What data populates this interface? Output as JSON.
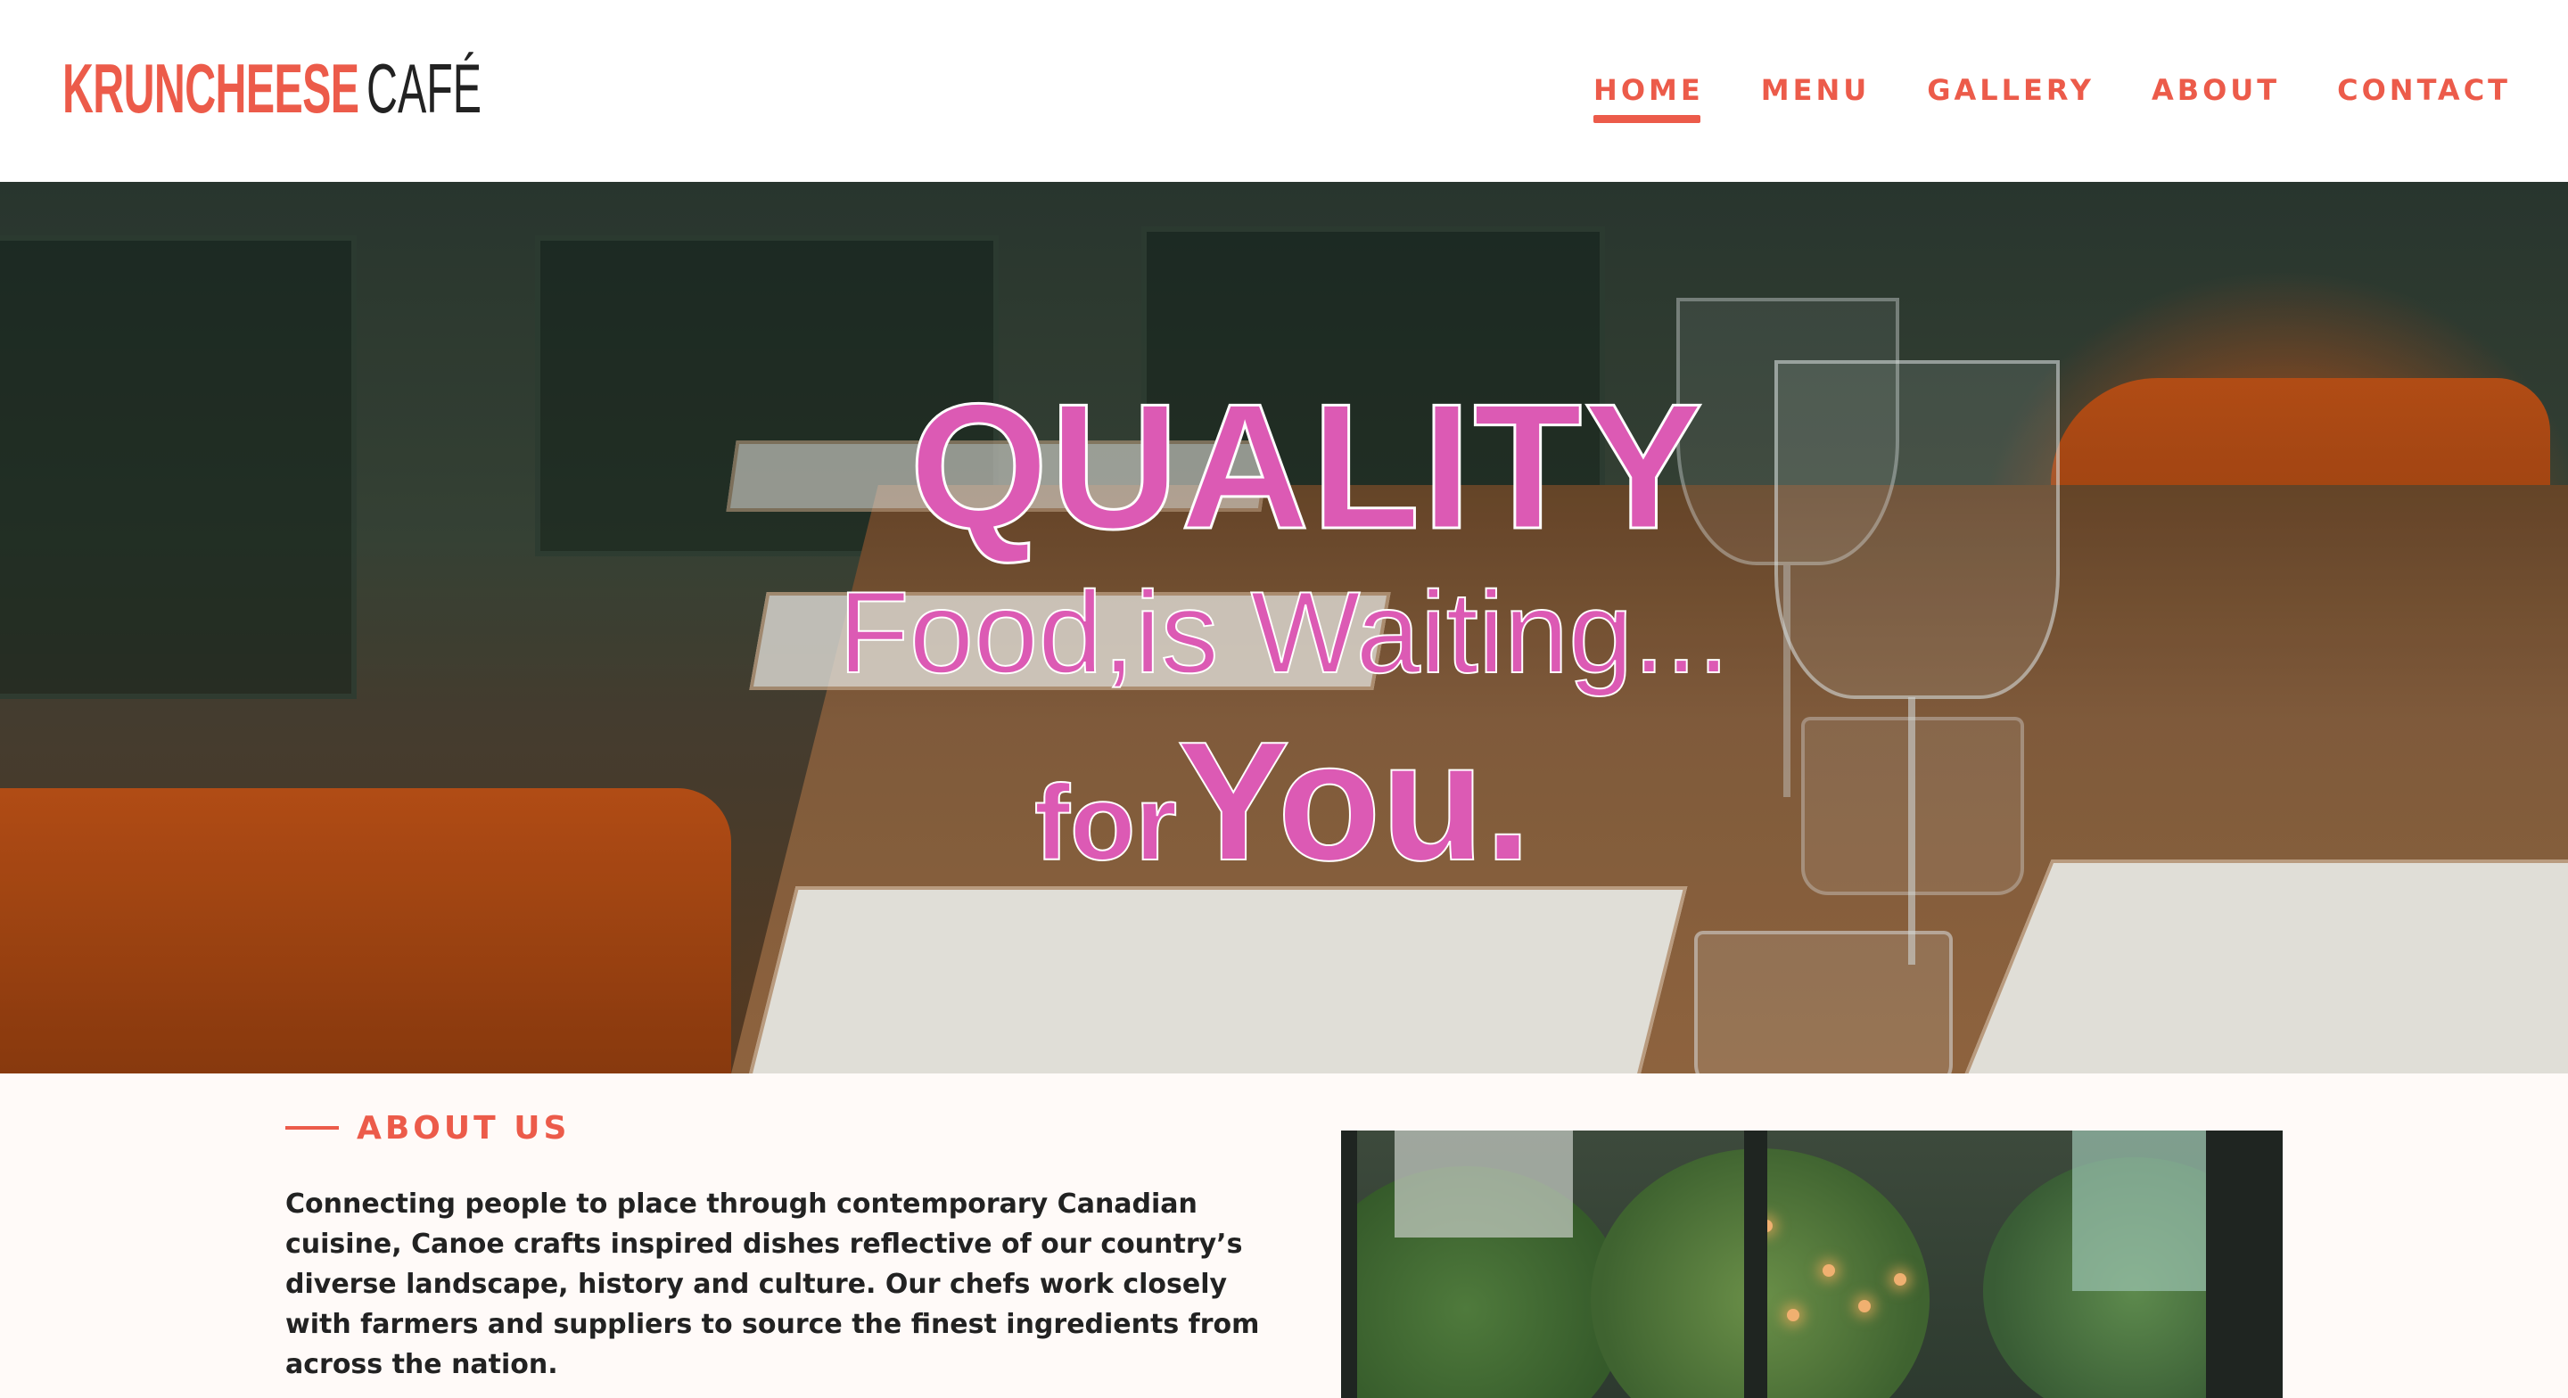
{
  "brand": {
    "name_main": "KRUNCHEESE",
    "name_sub": "CAFÉ",
    "accent_color": "#ec5b4a"
  },
  "nav": {
    "items": [
      {
        "label": "HOME",
        "active": true
      },
      {
        "label": "MENU",
        "active": false
      },
      {
        "label": "GALLERY",
        "active": false
      },
      {
        "label": "ABOUT",
        "active": false
      },
      {
        "label": "CONTACT",
        "active": false
      }
    ]
  },
  "hero": {
    "line1": "QUALITY",
    "line2": "Food,is Waiting...",
    "line3_small": "for",
    "line3_large": "You.",
    "text_color": "#dc5ab4"
  },
  "about": {
    "heading": "ABOUT US",
    "paragraph": "Connecting people to place through contemporary Canadian cuisine, Canoe crafts inspired dishes reflective of our country’s diverse landscape, history and culture. Our chefs work closely with farmers and suppliers to source the finest ingredients from across the nation.",
    "paragraph2": ""
  }
}
